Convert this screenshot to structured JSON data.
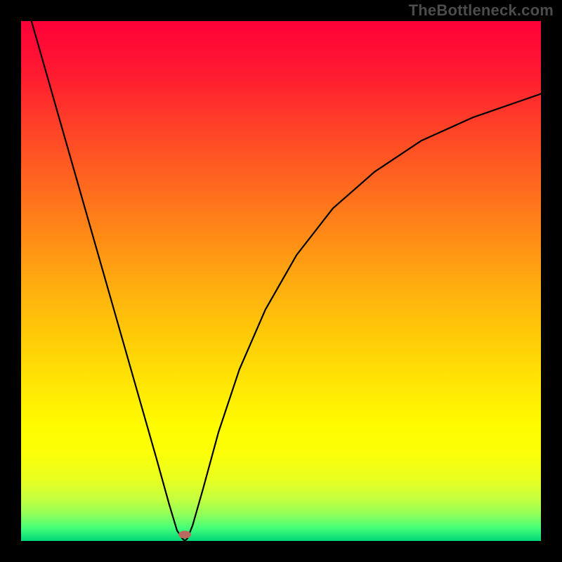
{
  "watermark": "TheBottleneck.com",
  "chart_data": {
    "type": "line",
    "title": "",
    "xlabel": "",
    "ylabel": "",
    "xlim": [
      0,
      1
    ],
    "ylim": [
      0,
      1
    ],
    "grid": false,
    "x": [
      0.02,
      0.05,
      0.08,
      0.11,
      0.14,
      0.17,
      0.2,
      0.23,
      0.26,
      0.285,
      0.3,
      0.31,
      0.315,
      0.32,
      0.33,
      0.35,
      0.38,
      0.42,
      0.47,
      0.53,
      0.6,
      0.68,
      0.77,
      0.87,
      1.0
    ],
    "values": [
      1.0,
      0.895,
      0.79,
      0.685,
      0.58,
      0.475,
      0.37,
      0.265,
      0.16,
      0.07,
      0.02,
      0.005,
      0.0,
      0.005,
      0.03,
      0.1,
      0.21,
      0.33,
      0.445,
      0.55,
      0.64,
      0.71,
      0.77,
      0.815,
      0.86
    ],
    "background_gradient": {
      "stops": [
        {
          "pos": 0.0,
          "color": "#ff0039"
        },
        {
          "pos": 0.1,
          "color": "#ff1a30"
        },
        {
          "pos": 0.2,
          "color": "#ff4028"
        },
        {
          "pos": 0.3,
          "color": "#ff6320"
        },
        {
          "pos": 0.4,
          "color": "#ff8618"
        },
        {
          "pos": 0.5,
          "color": "#ffaa10"
        },
        {
          "pos": 0.6,
          "color": "#ffc908"
        },
        {
          "pos": 0.7,
          "color": "#ffe604"
        },
        {
          "pos": 0.78,
          "color": "#fffc00"
        },
        {
          "pos": 0.83,
          "color": "#fcff08"
        },
        {
          "pos": 0.88,
          "color": "#eaff20"
        },
        {
          "pos": 0.92,
          "color": "#c4ff40"
        },
        {
          "pos": 0.95,
          "color": "#8fff5b"
        },
        {
          "pos": 0.975,
          "color": "#45ff78"
        },
        {
          "pos": 1.0,
          "color": "#00d77a"
        }
      ]
    },
    "marker": {
      "x": 0.315,
      "y": 0.012,
      "color": "#b96a5e"
    },
    "line_color": "#000000",
    "line_width": 2.2
  }
}
